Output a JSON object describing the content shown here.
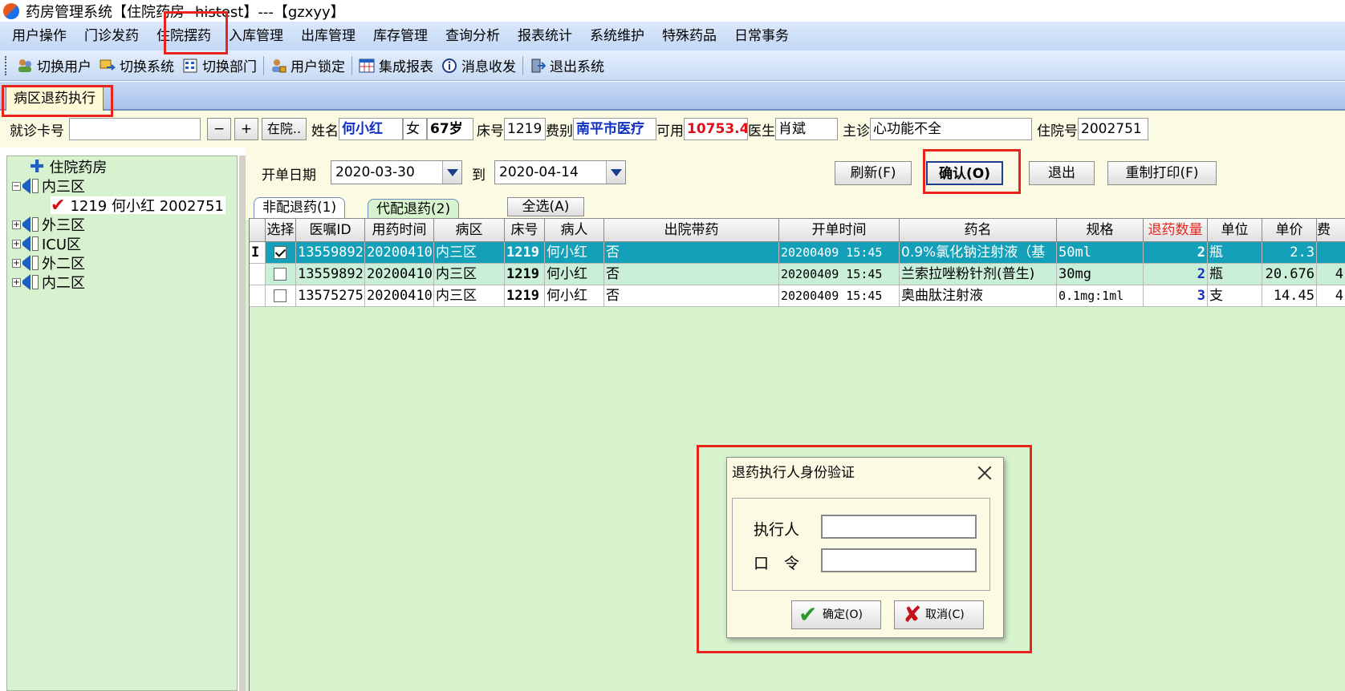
{
  "window": {
    "title": "药房管理系统【住院药房--histest】---【gzxyy】"
  },
  "menu": [
    "用户操作",
    "门诊发药",
    "住院摆药",
    "入库管理",
    "出库管理",
    "库存管理",
    "查询分析",
    "报表统计",
    "系统维护",
    "特殊药品",
    "日常事务"
  ],
  "toolbar": [
    "切换用户",
    "切换系统",
    "切换部门",
    "用户锁定",
    "集成报表",
    "消息收发",
    "退出系统"
  ],
  "doc_tab": "病区退药执行",
  "patient": {
    "card_label": "就诊卡号",
    "card_value": "",
    "minus": "−",
    "plus": "+",
    "status_btn": "在院..",
    "name_label": "姓名",
    "name": "何小红",
    "sex": "女",
    "age": "67岁",
    "bed_label": "床号",
    "bed": "1219",
    "fee_label": "费别",
    "fee": "南平市医疗",
    "avail_label": "可用",
    "avail": "10753.4",
    "doctor_label": "医生",
    "doctor": "肖斌",
    "diag_label": "主诊",
    "diag": "心功能不全",
    "inpatient_label": "住院号",
    "inpatient_no": "2002751"
  },
  "tree": {
    "root": "住院药房",
    "wards": [
      "内三区",
      "外三区",
      "ICU区",
      "外二区",
      "内二区"
    ],
    "patient_node": "1219 何小红 2002751"
  },
  "filter": {
    "start_label": "开单日期",
    "start_date": "2020-03-30",
    "to_label": "到",
    "end_date": "2020-04-14",
    "refresh": "刷新(F)",
    "confirm": "确认(O)",
    "exit": "退出",
    "reprint": "重制打印(F)"
  },
  "subtabs": {
    "tab1": "非配退药(1)",
    "tab2": "代配退药(2)",
    "select_all": "全选(A)"
  },
  "grid": {
    "columns": [
      "选择",
      "医嘱ID",
      "用药时间",
      "病区",
      "床号",
      "病人",
      "出院带药",
      "开单时间",
      "药名",
      "规格",
      "退药数量",
      "单位",
      "单价",
      "费"
    ],
    "rows": [
      {
        "checked": true,
        "id": "13559892",
        "use_time": "20200410",
        "ward": "内三区",
        "bed": "1219",
        "patient": "何小红",
        "discharge": "否",
        "order_time": "20200409 15:45",
        "drug": "0.9%氯化钠注射液（基",
        "spec": "50ml",
        "qty": "2",
        "unit": "瓶",
        "price": "2.3",
        "fee": ""
      },
      {
        "checked": false,
        "id": "13559892",
        "use_time": "20200410",
        "ward": "内三区",
        "bed": "1219",
        "patient": "何小红",
        "discharge": "否",
        "order_time": "20200409 15:45",
        "drug": "兰索拉唑粉针剂(普生)",
        "spec": "30mg",
        "qty": "2",
        "unit": "瓶",
        "price": "20.676",
        "fee": "4"
      },
      {
        "checked": false,
        "id": "13575275",
        "use_time": "20200410",
        "ward": "内三区",
        "bed": "1219",
        "patient": "何小红",
        "discharge": "否",
        "order_time": "20200409 15:45",
        "drug": "奥曲肽注射液",
        "spec": "0.1mg:1ml",
        "qty": "3",
        "unit": "支",
        "price": "14.45",
        "fee": "4"
      }
    ]
  },
  "dialog": {
    "title": "退药执行人身份验证",
    "executor_label": "执行人",
    "password_label": "口　令",
    "executor_value": "",
    "password_value": "",
    "ok": "确定(O)",
    "cancel": "取消(C)"
  },
  "colors": {
    "accent_red": "#e8241c",
    "selected_row": "#13a0b8",
    "tree_bg": "#d8f2cf"
  }
}
